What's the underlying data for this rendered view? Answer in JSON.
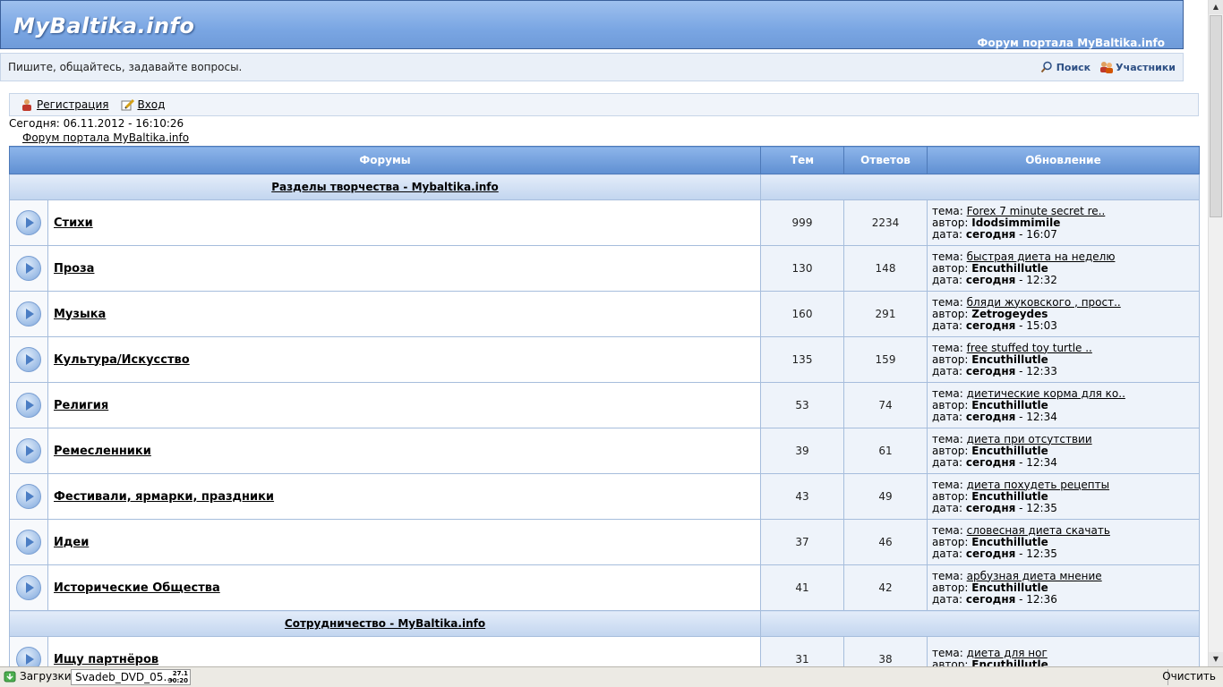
{
  "header": {
    "logo": "MyBaltika.info",
    "forum_link": "Форум портала MyBaltika.info"
  },
  "subbar": {
    "tagline": "Пишите, общайтесь, задавайте вопросы.",
    "search": "Поиск",
    "members": "Участники"
  },
  "userbar": {
    "register": "Регистрация",
    "login": "Вход"
  },
  "today": "Сегодня: 06.11.2012 - 16:10:26",
  "breadcrumb": "Форум портала MyBaltika.info",
  "table": {
    "headers": {
      "forums": "Форумы",
      "topics": "Тем",
      "replies": "Ответов",
      "updated": "Обновление"
    },
    "labels": {
      "topic": "тема:",
      "author": "автор:",
      "date": "дата:"
    },
    "categories": [
      {
        "title": "Разделы творчества - Mybaltika.info",
        "forums": [
          {
            "name": "Стихи",
            "topics": "999",
            "replies": "2234",
            "last_topic": "Forex 7 minute secret re..",
            "author": "Idodsimmimile",
            "day": "сегодня",
            "time": " - 16:07"
          },
          {
            "name": "Проза",
            "topics": "130",
            "replies": "148",
            "last_topic": "быстрая диета на неделю",
            "author": "Encuthillutle",
            "day": "сегодня",
            "time": " - 12:32"
          },
          {
            "name": "Музыка",
            "topics": "160",
            "replies": "291",
            "last_topic": "бляди жуковского , прост..",
            "author": "Zetrogeydes",
            "day": "сегодня",
            "time": " - 15:03"
          },
          {
            "name": "Культура/Искусство",
            "topics": "135",
            "replies": "159",
            "last_topic": "free stuffed toy turtle ..",
            "author": "Encuthillutle",
            "day": "сегодня",
            "time": " - 12:33"
          },
          {
            "name": "Религия",
            "topics": "53",
            "replies": "74",
            "last_topic": "диетические корма для ко..",
            "author": "Encuthillutle",
            "day": "сегодня",
            "time": " - 12:34"
          },
          {
            "name": "Ремесленники",
            "topics": "39",
            "replies": "61",
            "last_topic": "диета при отсутствии",
            "author": "Encuthillutle",
            "day": "сегодня",
            "time": " - 12:34"
          },
          {
            "name": "Фестивали, ярмарки, праздники",
            "topics": "43",
            "replies": "49",
            "last_topic": "диета похудеть рецепты",
            "author": "Encuthillutle",
            "day": "сегодня",
            "time": " - 12:35"
          },
          {
            "name": "Идеи",
            "topics": "37",
            "replies": "46",
            "last_topic": "словесная диета скачать",
            "author": "Encuthillutle",
            "day": "сегодня",
            "time": " - 12:35"
          },
          {
            "name": "Исторические Общества",
            "topics": "41",
            "replies": "42",
            "last_topic": "арбузная диета мнение",
            "author": "Encuthillutle",
            "day": "сегодня",
            "time": " - 12:36"
          }
        ]
      },
      {
        "title": "Сотрудничество - MyBaltika.info",
        "forums": [
          {
            "name": "Ищу партнёров",
            "topics": "31",
            "replies": "38",
            "last_topic": "диета для ног",
            "author": "Encuthillutle",
            "day": "",
            "time": ""
          }
        ]
      }
    ]
  },
  "downloads": {
    "label": "Загрузки",
    "file": "Svadeb_DVD_05...",
    "size_top": "27.1",
    "size_bottom": "30:20",
    "clear": "Очистить"
  }
}
